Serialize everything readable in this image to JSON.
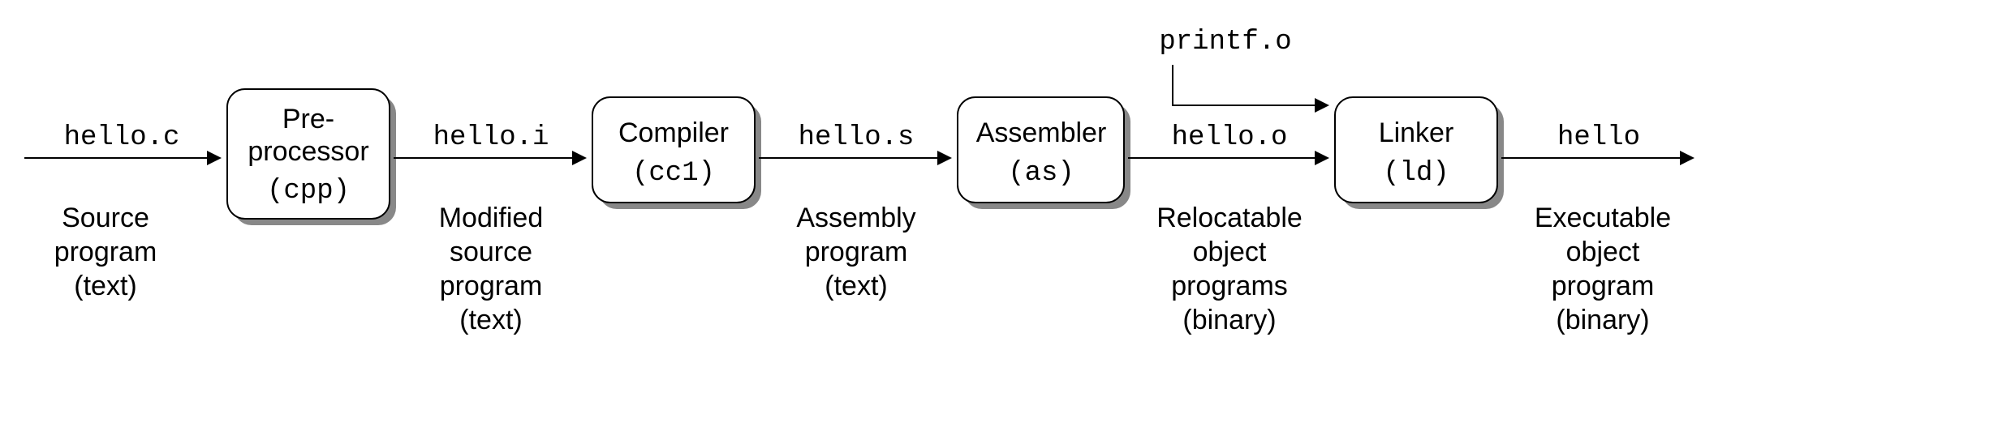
{
  "stages": {
    "preprocessor": {
      "line1": "Pre-",
      "line2": "processor",
      "tool": "(cpp)"
    },
    "compiler": {
      "line1": "Compiler",
      "tool": "(cc1)"
    },
    "assembler": {
      "line1": "Assembler",
      "tool": "(as)"
    },
    "linker": {
      "line1": "Linker",
      "tool": "(ld)"
    }
  },
  "arrows": {
    "a1": {
      "file": "hello.c",
      "desc1": "Source",
      "desc2": "program",
      "desc3": "(text)"
    },
    "a2": {
      "file": "hello.i",
      "desc1": "Modified",
      "desc2": "source",
      "desc3": "program",
      "desc4": "(text)"
    },
    "a3": {
      "file": "hello.s",
      "desc1": "Assembly",
      "desc2": "program",
      "desc3": "(text)"
    },
    "a4": {
      "file": "hello.o",
      "desc1": "Relocatable",
      "desc2": "object",
      "desc3": "programs",
      "desc4": "(binary)"
    },
    "a5": {
      "file": "hello",
      "desc1": "Executable",
      "desc2": "object",
      "desc3": "program",
      "desc4": "(binary)"
    }
  },
  "extra_input": {
    "file": "printf.o"
  }
}
